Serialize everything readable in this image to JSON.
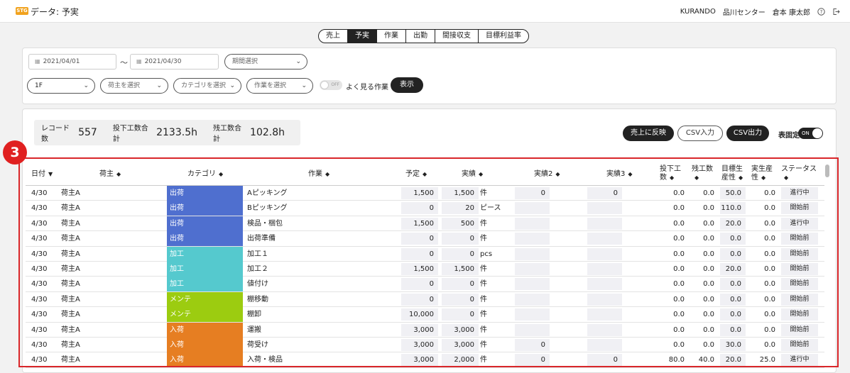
{
  "header": {
    "badge": "STG",
    "title": "データ: 予実",
    "company": "KURANDO",
    "site": "品川センター",
    "user": "倉本 康太郎"
  },
  "tabs": [
    {
      "label": "売上",
      "active": false
    },
    {
      "label": "予実",
      "active": true
    },
    {
      "label": "作業",
      "active": false
    },
    {
      "label": "出勤",
      "active": false
    },
    {
      "label": "間接収支",
      "active": false
    },
    {
      "label": "目標利益率",
      "active": false
    }
  ],
  "filters": {
    "date_from": "2021/04/01",
    "date_to": "2021/04/30",
    "separator": "～",
    "period_placeholder": "期間選択",
    "floor": "1F",
    "shipper_placeholder": "荷主を選択",
    "category_placeholder": "カテゴリを選択",
    "work_placeholder": "作業を選択",
    "toggle_state": "OFF",
    "toggle_label": "よく見る作業",
    "show_button": "表示"
  },
  "summary": {
    "records_label": "レコード数",
    "records_value": "557",
    "input_hours_label": "投下工数合計",
    "input_hours_value": "2133.5h",
    "overtime_label": "残工数合計",
    "overtime_value": "102.8h"
  },
  "actions": {
    "reflect_button": "売上に反映",
    "csv_in_button": "CSV入力",
    "csv_out_button": "CSV出力",
    "fixed_label": "表固定",
    "fixed_toggle": "ON"
  },
  "callout": "3",
  "columns": {
    "date": "日付",
    "shipper": "荷主",
    "category": "カテゴリ",
    "work": "作業",
    "plan": "予定",
    "actual": "実績",
    "actual2": "実績2",
    "actual3": "実績3",
    "input_line1": "投下工",
    "input_line2": "数",
    "remaining_line1": "残工数",
    "target_line1": "目標生",
    "target_line2": "産性",
    "real_line1": "実生産",
    "real_line2": "性",
    "status": "ステータス"
  },
  "category_colors": {
    "出荷": "#4f6fcf",
    "加工": "#55c9ce",
    "メンテ": "#9ccc10",
    "入荷": "#e67e22"
  },
  "rows": [
    {
      "date": "4/30",
      "shipper": "荷主A",
      "category": "出荷",
      "work": "Aピッキング",
      "plan": "1,500",
      "actual": "1,500",
      "unit": "件",
      "actual2": "0",
      "actual3": "0",
      "input": "0.0",
      "remaining": "0.0",
      "target": "50.0",
      "real": "0.0",
      "status": "進行中"
    },
    {
      "date": "4/30",
      "shipper": "荷主A",
      "category": "出荷",
      "work": "Bピッキング",
      "plan": "0",
      "actual": "20",
      "unit": "ピース",
      "actual2": "",
      "actual3": "",
      "input": "0.0",
      "remaining": "0.0",
      "target": "110.0",
      "real": "0.0",
      "status": "開始前"
    },
    {
      "date": "4/30",
      "shipper": "荷主A",
      "category": "出荷",
      "work": "検品・梱包",
      "plan": "1,500",
      "actual": "500",
      "unit": "件",
      "actual2": "",
      "actual3": "",
      "input": "0.0",
      "remaining": "0.0",
      "target": "20.0",
      "real": "0.0",
      "status": "進行中"
    },
    {
      "date": "4/30",
      "shipper": "荷主A",
      "category": "出荷",
      "work": "出荷準備",
      "plan": "0",
      "actual": "0",
      "unit": "件",
      "actual2": "",
      "actual3": "",
      "input": "0.0",
      "remaining": "0.0",
      "target": "0.0",
      "real": "0.0",
      "status": "開始前"
    },
    {
      "date": "4/30",
      "shipper": "荷主A",
      "category": "加工",
      "work": "加工１",
      "plan": "0",
      "actual": "0",
      "unit": "pcs",
      "actual2": "",
      "actual3": "",
      "input": "0.0",
      "remaining": "0.0",
      "target": "0.0",
      "real": "0.0",
      "status": "開始前"
    },
    {
      "date": "4/30",
      "shipper": "荷主A",
      "category": "加工",
      "work": "加工２",
      "plan": "1,500",
      "actual": "1,500",
      "unit": "件",
      "actual2": "",
      "actual3": "",
      "input": "0.0",
      "remaining": "0.0",
      "target": "20.0",
      "real": "0.0",
      "status": "開始前"
    },
    {
      "date": "4/30",
      "shipper": "荷主A",
      "category": "加工",
      "work": "値付け",
      "plan": "0",
      "actual": "0",
      "unit": "件",
      "actual2": "",
      "actual3": "",
      "input": "0.0",
      "remaining": "0.0",
      "target": "0.0",
      "real": "0.0",
      "status": "開始前"
    },
    {
      "date": "4/30",
      "shipper": "荷主A",
      "category": "メンテ",
      "work": "棚移動",
      "plan": "0",
      "actual": "0",
      "unit": "件",
      "actual2": "",
      "actual3": "",
      "input": "0.0",
      "remaining": "0.0",
      "target": "0.0",
      "real": "0.0",
      "status": "開始前"
    },
    {
      "date": "4/30",
      "shipper": "荷主A",
      "category": "メンテ",
      "work": "棚卸",
      "plan": "10,000",
      "actual": "0",
      "unit": "件",
      "actual2": "",
      "actual3": "",
      "input": "0.0",
      "remaining": "0.0",
      "target": "0.0",
      "real": "0.0",
      "status": "開始前"
    },
    {
      "date": "4/30",
      "shipper": "荷主A",
      "category": "入荷",
      "work": "運搬",
      "plan": "3,000",
      "actual": "3,000",
      "unit": "件",
      "actual2": "",
      "actual3": "",
      "input": "0.0",
      "remaining": "0.0",
      "target": "0.0",
      "real": "0.0",
      "status": "開始前"
    },
    {
      "date": "4/30",
      "shipper": "荷主A",
      "category": "入荷",
      "work": "荷受け",
      "plan": "3,000",
      "actual": "3,000",
      "unit": "件",
      "actual2": "0",
      "actual3": "",
      "input": "0.0",
      "remaining": "0.0",
      "target": "30.0",
      "real": "0.0",
      "status": "開始前"
    },
    {
      "date": "4/30",
      "shipper": "荷主A",
      "category": "入荷",
      "work": "入荷・検品",
      "plan": "3,000",
      "actual": "2,000",
      "unit": "件",
      "actual2": "0",
      "actual3": "0",
      "input": "80.0",
      "remaining": "40.0",
      "target": "20.0",
      "real": "25.0",
      "status": "進行中"
    }
  ]
}
